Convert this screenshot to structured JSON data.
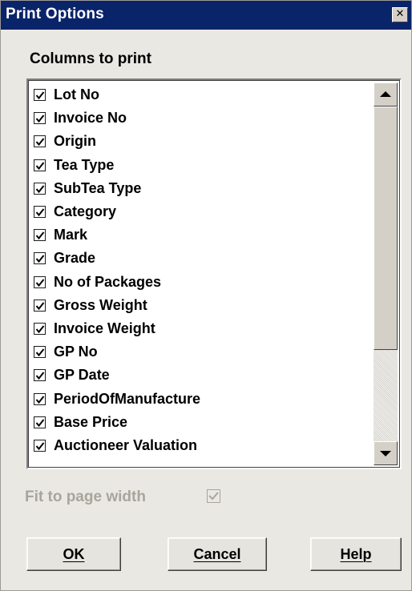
{
  "window": {
    "title": "Print Options",
    "close_glyph": "✕"
  },
  "columns_section": {
    "label": "Columns to print",
    "items": [
      {
        "label": "Lot No",
        "checked": true
      },
      {
        "label": "Invoice No",
        "checked": true
      },
      {
        "label": "Origin",
        "checked": true
      },
      {
        "label": "Tea Type",
        "checked": true
      },
      {
        "label": "SubTea Type",
        "checked": true
      },
      {
        "label": "Category",
        "checked": true
      },
      {
        "label": "Mark",
        "checked": true
      },
      {
        "label": "Grade",
        "checked": true
      },
      {
        "label": "No of Packages",
        "checked": true
      },
      {
        "label": "Gross Weight",
        "checked": true
      },
      {
        "label": "Invoice Weight",
        "checked": true
      },
      {
        "label": "GP No",
        "checked": true
      },
      {
        "label": "GP Date",
        "checked": true
      },
      {
        "label": "PeriodOfManufacture",
        "checked": true
      },
      {
        "label": "Base Price",
        "checked": true
      },
      {
        "label": "Auctioneer Valuation",
        "checked": true
      }
    ]
  },
  "fit_to_page": {
    "label": "Fit to page width",
    "checked": true,
    "enabled": false
  },
  "buttons": {
    "ok": {
      "mnemonic": "O",
      "rest": "K"
    },
    "cancel": {
      "mnemonic": "C",
      "rest": "ancel"
    },
    "help": {
      "mnemonic": "H",
      "rest": "elp"
    }
  },
  "colors": {
    "titlebar": "#0a246a",
    "dialog_bg": "#eae8e3",
    "disabled_text": "#a8a59d"
  },
  "icons": {
    "checkbox_checked": "check-icon",
    "scroll_up": "arrow-up-icon",
    "scroll_down": "arrow-down-icon",
    "close": "close-icon"
  }
}
